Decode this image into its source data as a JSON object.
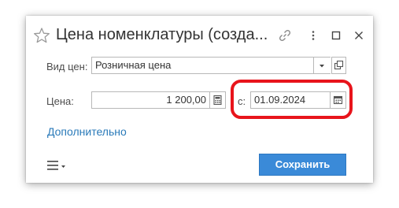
{
  "window": {
    "title": "Цена номенклатуры (созда...",
    "star_icon": "star-icon",
    "link_icon": "link-icon",
    "more_icon": "more-icon",
    "maximize_icon": "maximize-icon",
    "close_icon": "close-icon"
  },
  "form": {
    "price_type_label": "Вид цен:",
    "price_type_value": "Розничная цена",
    "price_label": "Цена:",
    "price_value": "1 200,00",
    "date_label": "с:",
    "date_value": "01.09.2024"
  },
  "footer": {
    "more_link": "Дополнительно",
    "save_label": "Сохранить"
  },
  "colors": {
    "accent": "#3a8ad8",
    "link": "#2a7ab9",
    "highlight": "#e8141b"
  }
}
